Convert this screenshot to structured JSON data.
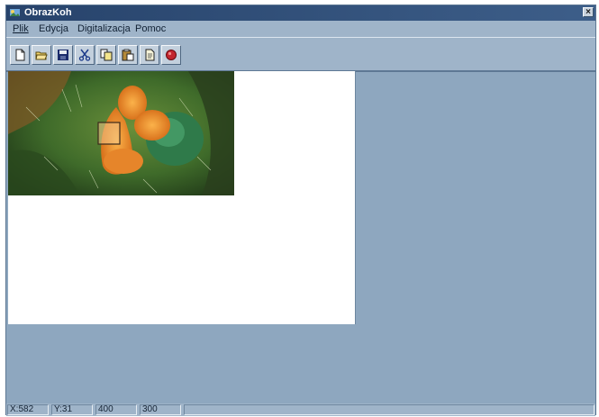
{
  "window": {
    "title": "ObrazKoh",
    "close_glyph": "×"
  },
  "menu": [
    {
      "label": "Plik"
    },
    {
      "label": "Edycja"
    },
    {
      "label": "Digitalizacja"
    },
    {
      "label": "Pomoc"
    }
  ],
  "toolbar": {
    "buttons": [
      {
        "icon": "new-document-icon"
      },
      {
        "icon": "open-folder-icon"
      },
      {
        "icon": "save-disk-icon"
      },
      {
        "icon": "cut-scissors-icon"
      },
      {
        "icon": "copy-icon"
      },
      {
        "icon": "paste-icon"
      },
      {
        "icon": "document-icon"
      },
      {
        "icon": "record-red-icon"
      }
    ]
  },
  "status": {
    "x": "X:582",
    "y": "Y:31",
    "w": "400",
    "h": "300",
    "extra": ""
  },
  "colors": {
    "window_bg": "#8ea7bf",
    "titlebar": "#27436b",
    "canvas": "#ffffff"
  }
}
